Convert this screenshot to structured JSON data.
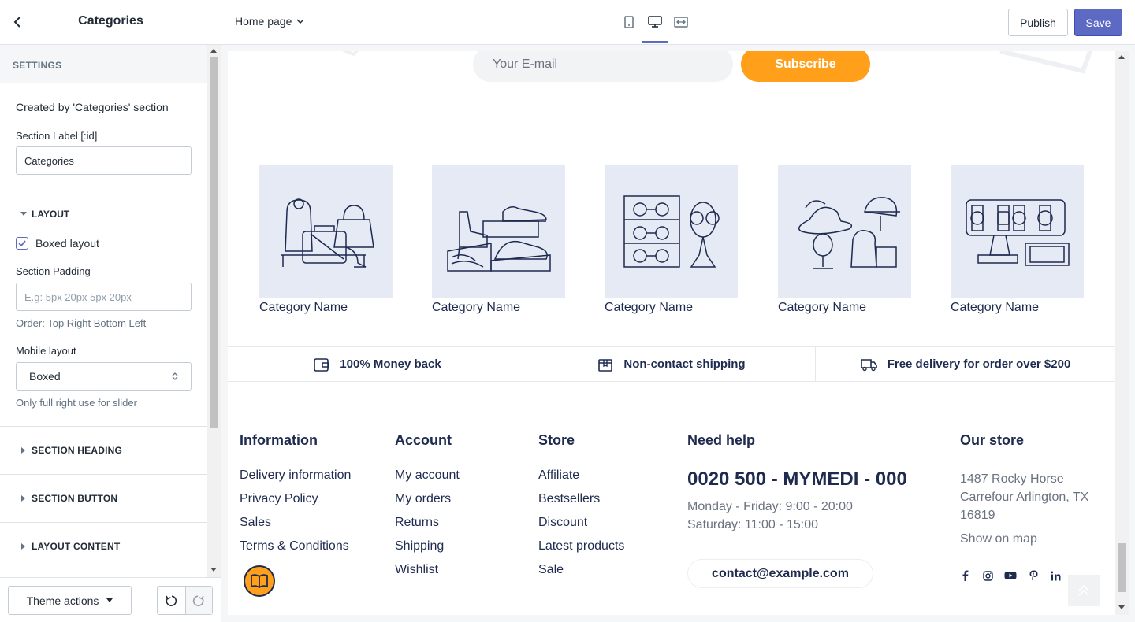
{
  "topbar": {
    "sidebar_title": "Categories",
    "page_selector": "Home page",
    "publish_label": "Publish",
    "save_label": "Save",
    "devices": [
      "mobile-icon",
      "desktop-icon",
      "fullwidth-icon"
    ],
    "active_device": "desktop",
    "accent_color": "#5c6ac4"
  },
  "sidebar": {
    "settings_heading": "SETTINGS",
    "created_by": "Created by 'Categories' section",
    "section_label_title": "Section Label [:id]",
    "section_label_value": "Categories",
    "layout_heading": "LAYOUT",
    "boxed_layout_label": "Boxed layout",
    "boxed_layout_checked": true,
    "section_padding_label": "Section Padding",
    "section_padding_placeholder": "E.g: 5px 20px 5px 20px",
    "padding_hint": "Order: Top Right Bottom Left",
    "mobile_layout_label": "Mobile layout",
    "mobile_layout_value": "Boxed",
    "mobile_hint": "Only full right use for slider",
    "collapsed_sections": [
      "SECTION HEADING",
      "SECTION BUTTON",
      "LAYOUT CONTENT"
    ],
    "theme_actions_label": "Theme actions"
  },
  "preview": {
    "email_placeholder": "Your E-mail",
    "subscribe_label": "Subscribe",
    "subscribe_color": "#ff9f1a",
    "categories": [
      {
        "name": "Category Name",
        "icon": "bags-icon"
      },
      {
        "name": "Category Name",
        "icon": "shoes-icon"
      },
      {
        "name": "Category Name",
        "icon": "glasses-icon"
      },
      {
        "name": "Category Name",
        "icon": "hats-icon"
      },
      {
        "name": "Category Name",
        "icon": "watches-icon"
      }
    ],
    "features": [
      {
        "label": "100% Money back",
        "icon": "wallet-icon"
      },
      {
        "label": "Non-contact shipping",
        "icon": "box-icon"
      },
      {
        "label": "Free delivery for order over $200",
        "icon": "truck-icon"
      }
    ],
    "footer": {
      "information": {
        "heading": "Information",
        "links": [
          "Delivery information",
          "Privacy Policy",
          "Sales",
          "Terms & Conditions"
        ]
      },
      "account": {
        "heading": "Account",
        "links": [
          "My account",
          "My orders",
          "Returns",
          "Shipping",
          "Wishlist"
        ]
      },
      "store": {
        "heading": "Store",
        "links": [
          "Affiliate",
          "Bestsellers",
          "Discount",
          "Latest products",
          "Sale"
        ]
      },
      "help": {
        "heading": "Need help",
        "phone": "0020 500 - MYMEDI - 000",
        "hours1": "Monday - Friday: 9:00 - 20:00",
        "hours2": "Saturday: 11:00 - 15:00",
        "email": "contact@example.com"
      },
      "our_store": {
        "heading": "Our store",
        "addr1": "1487 Rocky Horse",
        "addr2": "Carrefour Arlington, TX",
        "addr3": "16819",
        "map_label": "Show on map",
        "socials": [
          "facebook-icon",
          "instagram-icon",
          "youtube-icon",
          "pinterest-icon",
          "linkedin-icon"
        ]
      }
    }
  }
}
